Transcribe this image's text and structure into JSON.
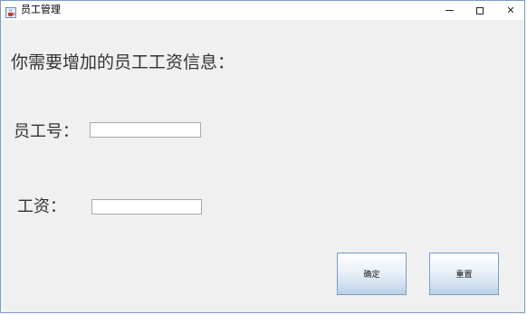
{
  "window": {
    "title": "员工管理",
    "icons": {
      "app": "java-coffee-icon",
      "minimize": "minimize-icon",
      "maximize": "maximize-icon",
      "close": "close-icon"
    },
    "close_glyph": "✕"
  },
  "form": {
    "heading": "你需要增加的员工工资信息：",
    "employee_id_label": "员工号：",
    "employee_id_value": "",
    "salary_label": "工资：",
    "salary_value": ""
  },
  "buttons": {
    "confirm_label": "确定",
    "reset_label": "重置"
  },
  "colors": {
    "window_background": "#f0f0f0",
    "titlebar_background": "#ffffff",
    "button_border": "#7a9cc6"
  }
}
